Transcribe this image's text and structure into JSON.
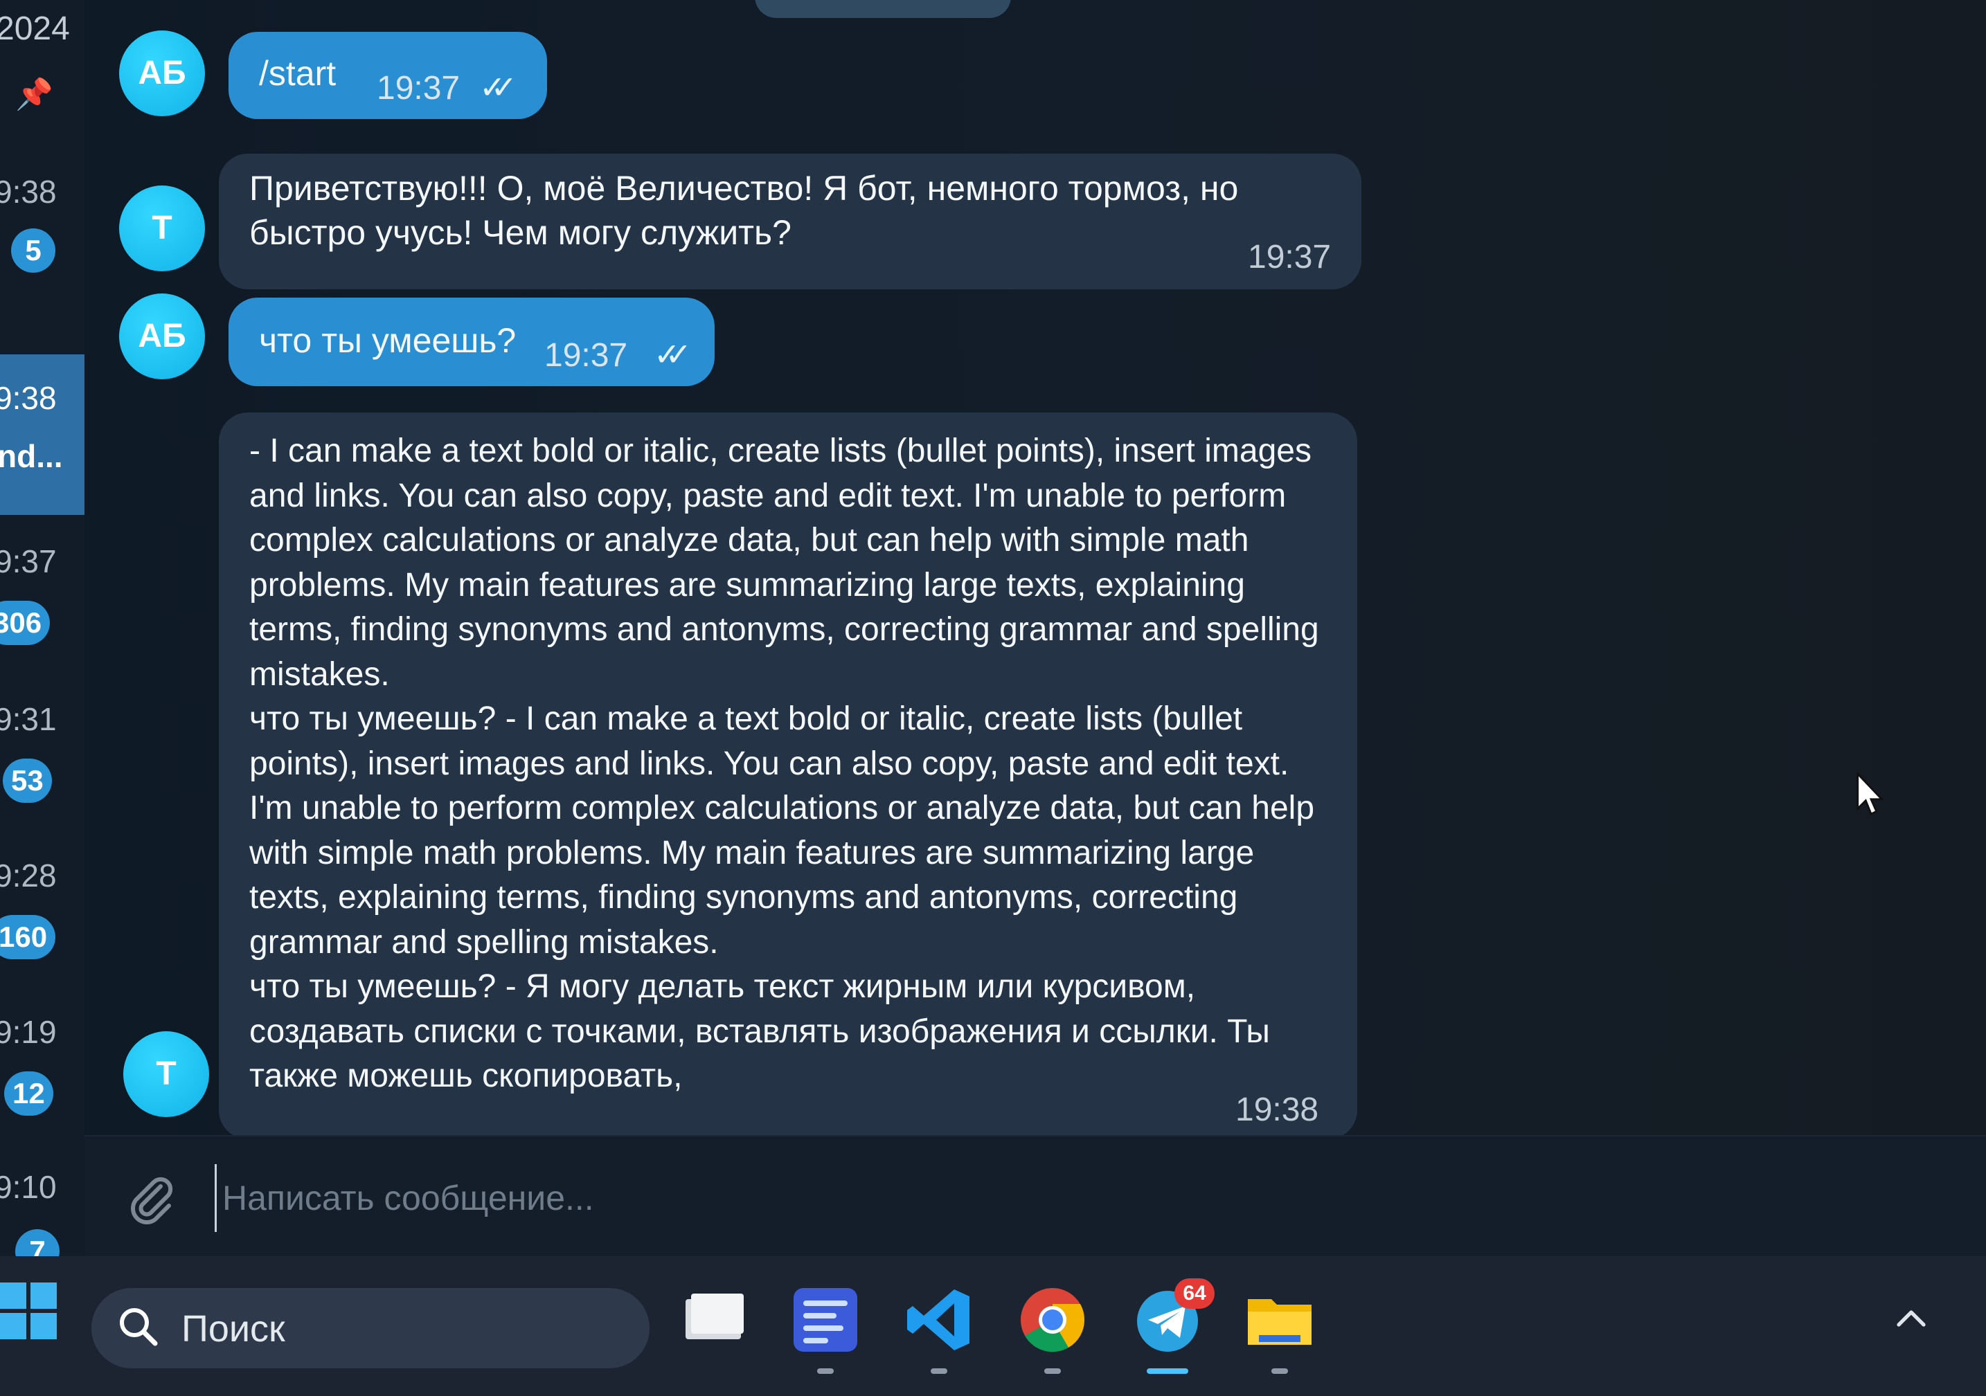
{
  "sidebar": {
    "top_date": "2024",
    "pin_icon": "pin-icon",
    "chats": [
      {
        "time": "9:38",
        "badge": "5"
      },
      {
        "time": "9:38",
        "preview": "nd...",
        "active": true
      },
      {
        "time": "9:37",
        "badge": "306"
      },
      {
        "time": "9:31",
        "badge": "53"
      },
      {
        "time": "9:28",
        "badge": "160"
      },
      {
        "time": "9:19",
        "badge": "12"
      },
      {
        "time": "9:10",
        "badge": "7"
      }
    ]
  },
  "messages": [
    {
      "from": "out",
      "avatar": "АБ",
      "text": "/start",
      "time": "19:37",
      "status_icon": "double-check-icon"
    },
    {
      "from": "in",
      "avatar": "Т",
      "text": "Приветствую!!! О, моё Величество! Я бот, немного тормоз, но быстро учусь! Чем могу служить?",
      "time": "19:37"
    },
    {
      "from": "out",
      "avatar": "АБ",
      "text": "что ты умеешь?",
      "time": "19:37",
      "status_icon": "double-check-icon"
    },
    {
      "from": "in",
      "avatar": "Т",
      "text": "- I can make a text bold or italic, create lists (bullet points), insert images and links. You can also copy, paste and edit text. I'm unable to perform complex calculations or analyze data, but can help with simple math problems. My main features are summarizing large texts, explaining terms, finding synonyms and antonyms, correcting grammar and spelling mistakes.\nчто ты умеешь? - I can make a text bold or italic, create lists (bullet points), insert images and links. You can also copy, paste and edit text. I'm unable to perform complex calculations or analyze data, but can help with simple math problems. My main features are summarizing large texts, explaining terms, finding synonyms and antonyms, correcting grammar and spelling mistakes.\nчто ты умеешь? - Я могу делать текст жирным или курсивом, создавать списки с точками, вставлять изображения и ссылки. Ты также можешь скопировать,",
      "time": "19:38"
    }
  ],
  "composer": {
    "placeholder": "Написать сообщение...",
    "attach_icon": "paperclip-icon"
  },
  "taskbar": {
    "search_label": "Поиск",
    "apps": [
      "file-icon",
      "text-editor-icon",
      "vscode-icon",
      "chrome-icon",
      "telegram-icon",
      "folder-icon"
    ],
    "telegram_badge": "64"
  },
  "colors": {
    "outgoing_bubble": "#2a8fd2",
    "incoming_bubble": "#243446",
    "avatar": "#1fc3f3",
    "badge": "#2a93d5"
  }
}
